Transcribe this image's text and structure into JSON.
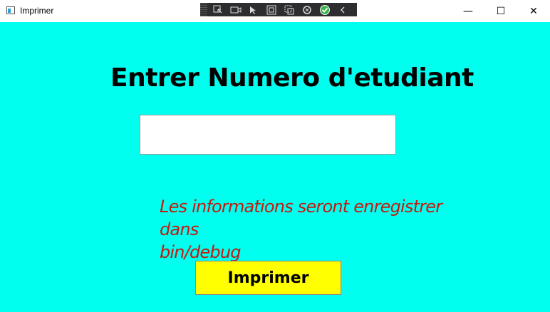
{
  "window": {
    "title": "Imprimer",
    "controls": {
      "minimize": "—",
      "maximize": "☐",
      "close": "✕"
    }
  },
  "debug_toolbar": {
    "buttons": [
      {
        "icon": "select-element-icon"
      },
      {
        "icon": "video-icon"
      },
      {
        "icon": "cursor-icon"
      },
      {
        "icon": "layout-adorner-icon"
      },
      {
        "icon": "track-focus-icon"
      },
      {
        "icon": "hot-reload-icon"
      },
      {
        "icon": "check-circle-icon"
      },
      {
        "icon": "collapse-chevron-icon"
      }
    ]
  },
  "form": {
    "heading": "Entrer Numero d'etudiant",
    "student_number_value": "",
    "info_text_line1": "Les informations seront enregistrer dans",
    "info_text_line2": "bin/debug",
    "print_button_label": "Imprimer"
  },
  "colors": {
    "background": "#00ffee",
    "info_text": "#c21a12",
    "button_bg": "#ffff00"
  }
}
